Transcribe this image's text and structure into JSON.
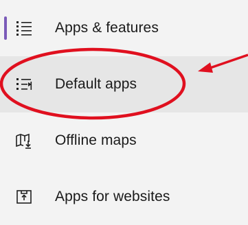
{
  "nav": {
    "items": [
      {
        "label": "Apps & features",
        "icon": "apps-features-icon",
        "selected": true
      },
      {
        "label": "Default apps",
        "icon": "default-apps-icon",
        "selected": false
      },
      {
        "label": "Offline maps",
        "icon": "offline-maps-icon",
        "selected": false
      },
      {
        "label": "Apps for websites",
        "icon": "apps-for-websites-icon",
        "selected": false
      }
    ]
  },
  "colors": {
    "accent": "#7a5ab8",
    "annotation": "#e0101f",
    "row_highlight": "#e6e6e6",
    "background": "#f3f3f3"
  },
  "annotation": {
    "shapes": [
      "circle",
      "arrow"
    ],
    "target": "Default apps"
  }
}
